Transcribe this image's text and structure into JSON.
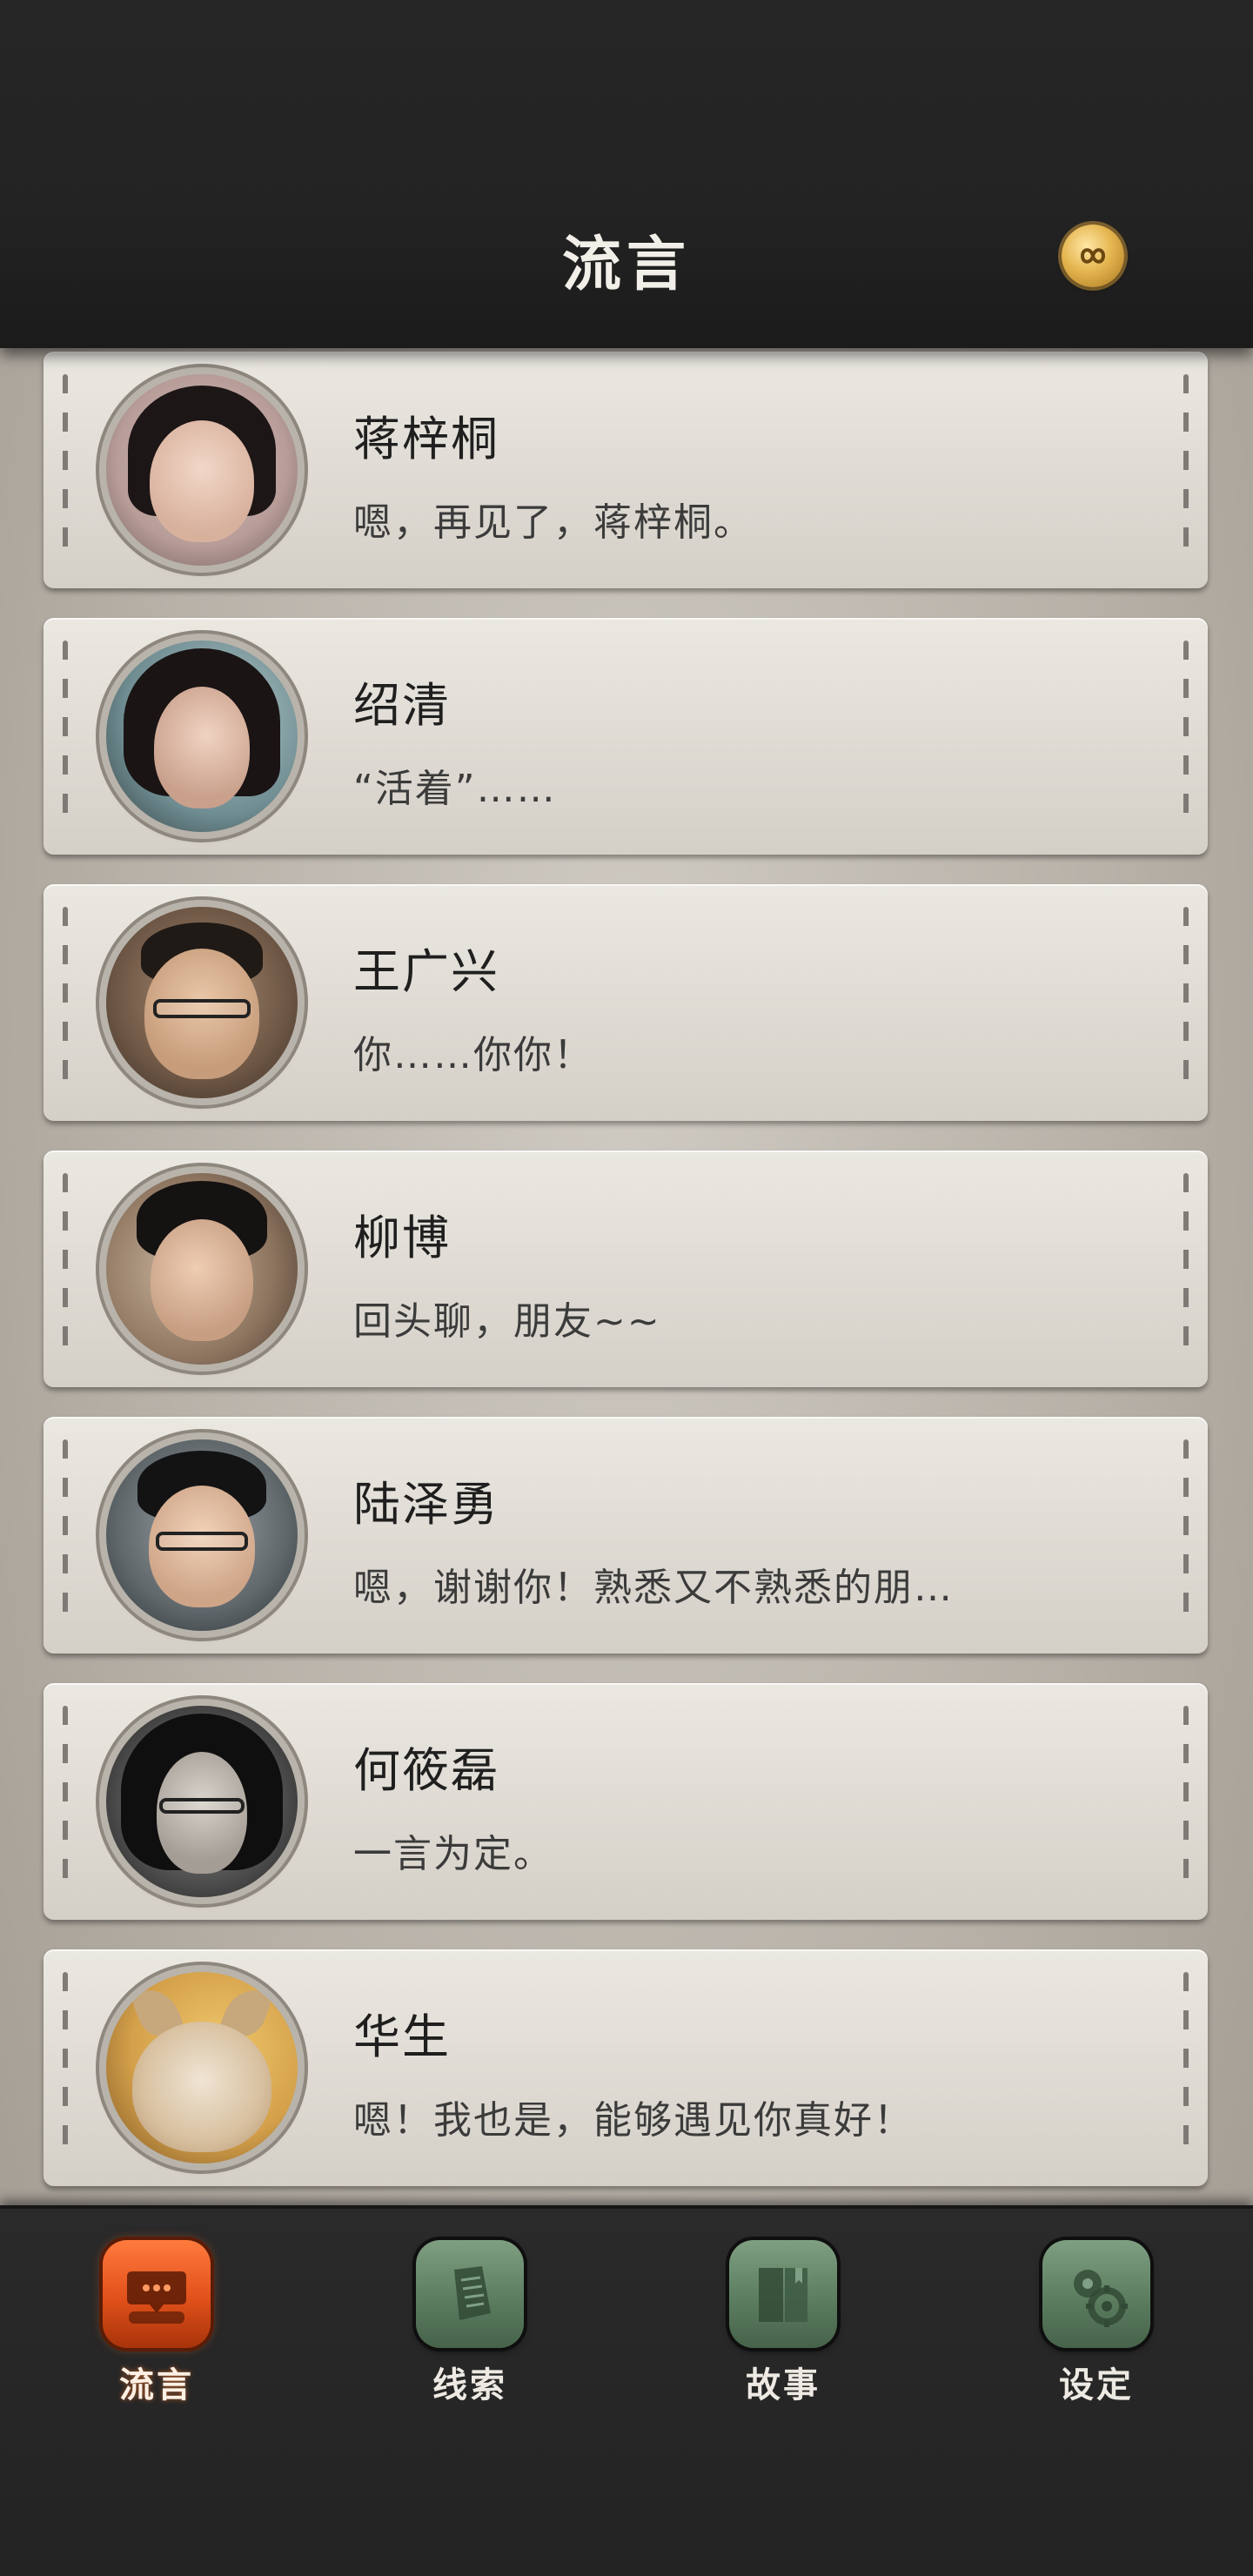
{
  "header": {
    "title": "流言",
    "right_icon": "infinity-icon"
  },
  "contacts": [
    {
      "name": "蒋梓桐",
      "message": "嗯，再见了，蒋梓桐。"
    },
    {
      "name": "绍清",
      "message": "“活着”……"
    },
    {
      "name": "王广兴",
      "message": "你……你你！"
    },
    {
      "name": "柳博",
      "message": "回头聊，朋友~~"
    },
    {
      "name": "陆泽勇",
      "message": "嗯，谢谢你！熟悉又不熟悉的朋…"
    },
    {
      "name": "何筱磊",
      "message": "一言为定。"
    },
    {
      "name": "华生",
      "message": "嗯！我也是，能够遇见你真好！"
    }
  ],
  "nav": {
    "items": [
      {
        "label": "流言",
        "icon": "chat-bubble-icon",
        "active": true
      },
      {
        "label": "线索",
        "icon": "document-icon",
        "active": false
      },
      {
        "label": "故事",
        "icon": "book-icon",
        "active": false
      },
      {
        "label": "设定",
        "icon": "gears-icon",
        "active": false
      }
    ]
  },
  "colors": {
    "header_bg": "#232323",
    "card_bg": "#e1ddd6",
    "active_tab": "#e1501a",
    "inactive_tab": "#5c7d60",
    "badge_gold": "#e5b650"
  }
}
